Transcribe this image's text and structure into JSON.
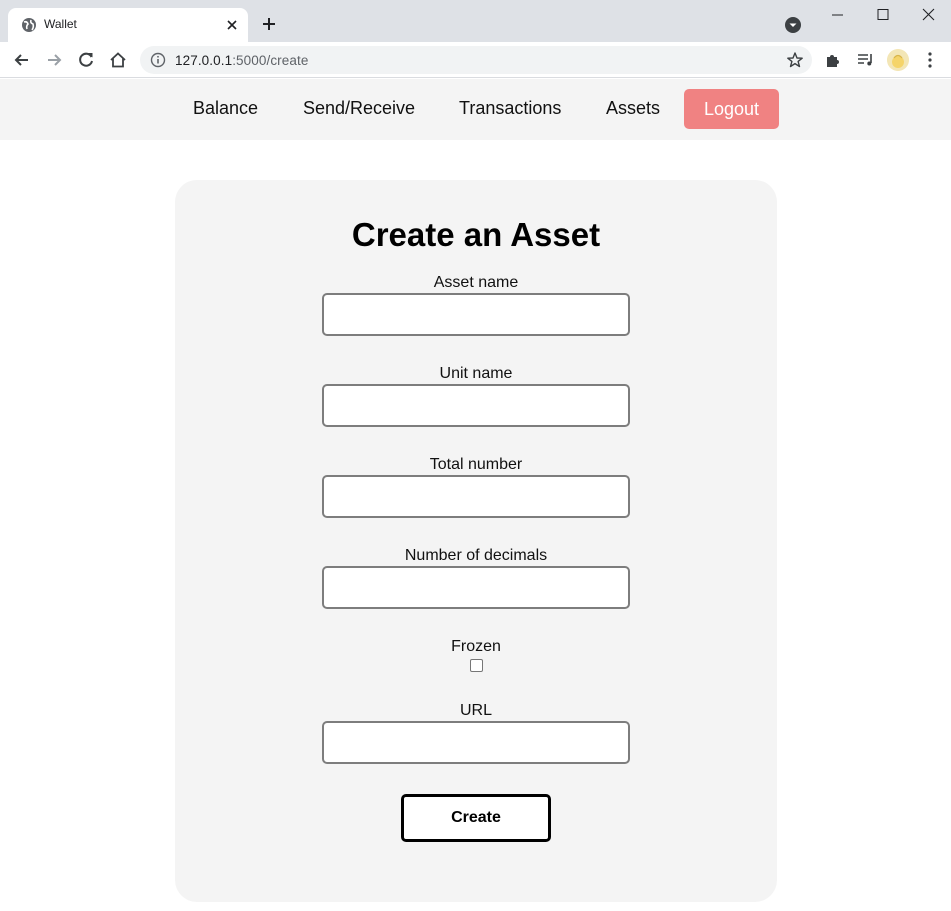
{
  "browser": {
    "tab_title": "Wallet",
    "url_host": "127.0.0.1",
    "url_rest": ":5000/create"
  },
  "nav": {
    "links": [
      "Balance",
      "Send/Receive",
      "Transactions",
      "Assets"
    ],
    "logout": "Logout",
    "logout_color": "#f08282"
  },
  "form": {
    "title": "Create an Asset",
    "fields": {
      "asset_name": {
        "label": "Asset name",
        "value": ""
      },
      "unit_name": {
        "label": "Unit name",
        "value": ""
      },
      "total_number": {
        "label": "Total number",
        "value": ""
      },
      "decimals": {
        "label": "Number of decimals",
        "value": ""
      },
      "frozen": {
        "label": "Frozen",
        "checked": false
      },
      "url": {
        "label": "URL",
        "value": ""
      }
    },
    "submit": "Create"
  },
  "icons": [
    "globe-icon",
    "close-icon",
    "plus-icon",
    "tab-search-icon",
    "minimize-icon",
    "maximize-icon",
    "window-close-icon",
    "back-icon",
    "forward-icon",
    "reload-icon",
    "home-icon",
    "info-icon",
    "star-icon",
    "extensions-icon",
    "media-icon",
    "kebab-menu-icon"
  ]
}
